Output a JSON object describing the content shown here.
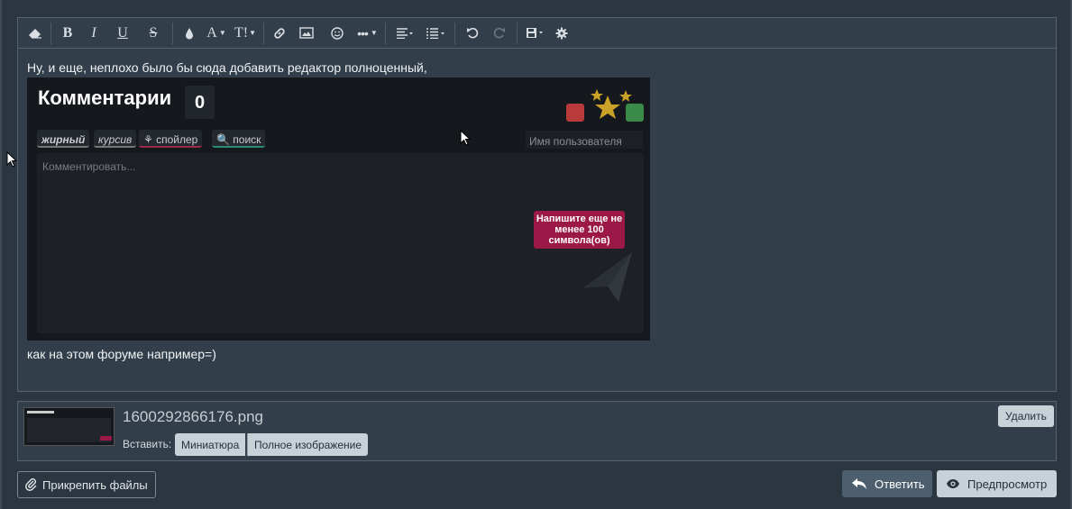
{
  "editor": {
    "line1": "Ну, и еще, неплохо было бы сюда добавить редактор полноценный,",
    "line2": "как на этом форуме например=)",
    "embedded": {
      "title": "Комментарии",
      "count": "0",
      "bold": "жирный",
      "italic": "курсив",
      "spoiler": "спойлер",
      "search": "поиск",
      "username_placeholder": "Имя пользователя",
      "comment_placeholder": "Комментировать...",
      "warning": "Напишите еще не менее 100 символа(ов)"
    }
  },
  "toolbar": {
    "items": [
      "eraser-icon",
      "bold-icon",
      "italic-icon",
      "underline-icon",
      "strikethrough-icon",
      "color-icon",
      "font-size-icon",
      "text-style-icon",
      "link-icon",
      "image-icon",
      "smile-icon",
      "more-icon",
      "align-icon",
      "list-icon",
      "undo-icon",
      "redo-icon",
      "save-icon",
      "settings-icon"
    ]
  },
  "attachment": {
    "filename": "1600292866176.png",
    "insert_label": "Вставить:",
    "thumbnail_button": "Миниатюра",
    "full_button": "Полное изображение",
    "delete_button": "Удалить"
  },
  "actions": {
    "attach_files": "Прикрепить файлы",
    "reply": "Ответить",
    "preview": "Предпросмотр"
  },
  "colors": {
    "accent_warning": "#9c1846",
    "panel": "#323e49",
    "background": "#2c3640"
  }
}
